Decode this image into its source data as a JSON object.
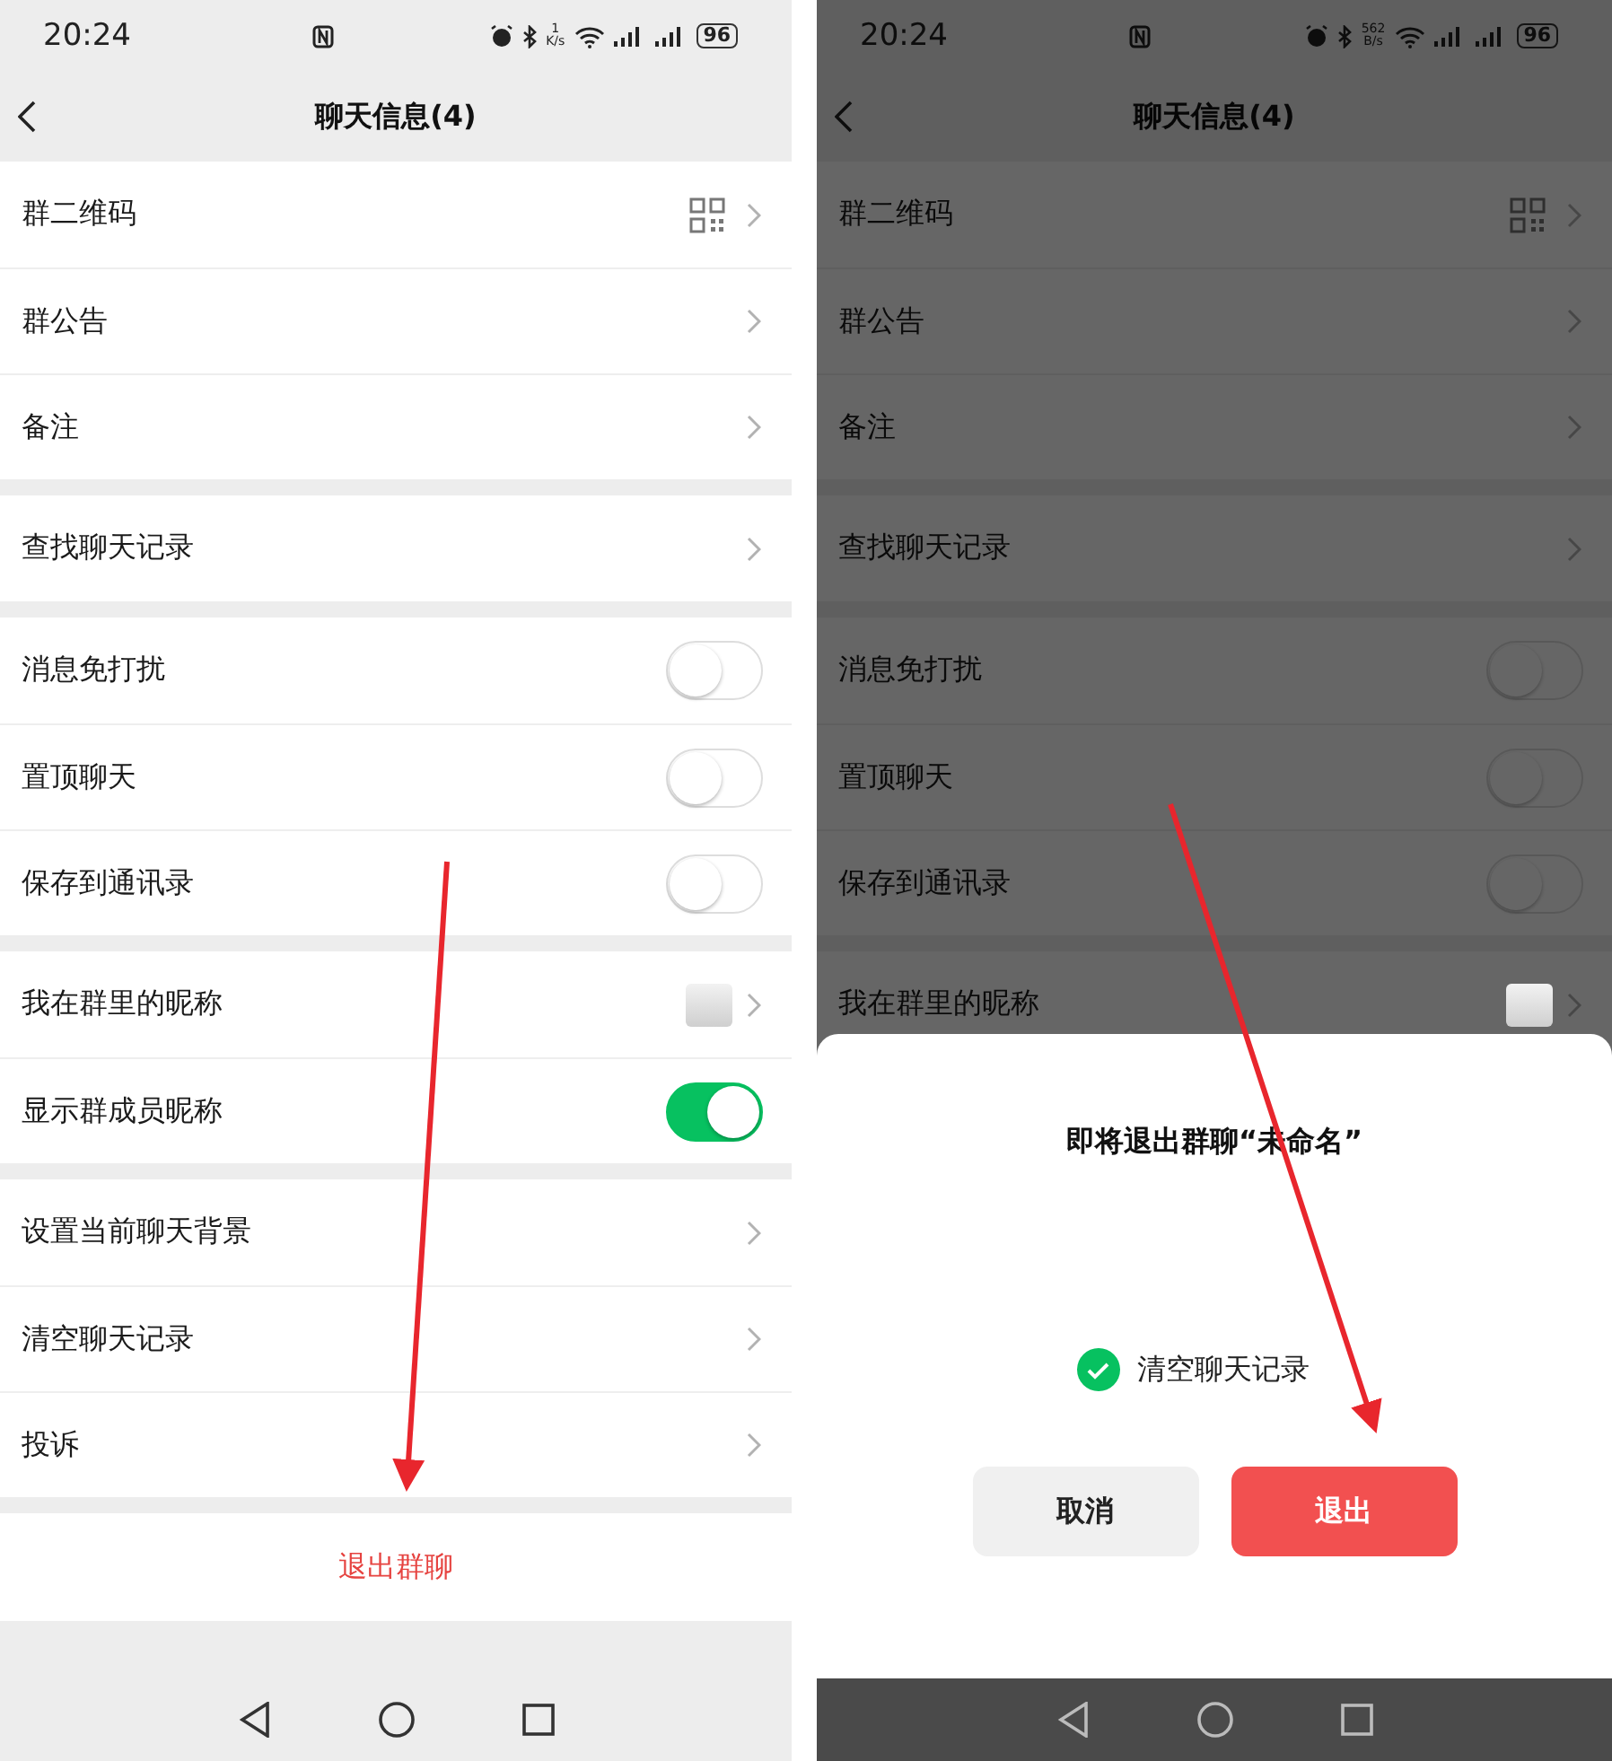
{
  "screens": [
    {
      "dimmed": false,
      "status_bar": {
        "time": "20:24",
        "speed_value": "1",
        "speed_unit": "K/s",
        "battery": "96"
      },
      "title": "聊天信息(4)",
      "groups": [
        [
          {
            "kind": "qr",
            "label": "群二维码"
          },
          {
            "kind": "link",
            "label": "群公告"
          },
          {
            "kind": "link",
            "label": "备注"
          }
        ],
        [
          {
            "kind": "link",
            "label": "查找聊天记录"
          }
        ],
        [
          {
            "kind": "toggle",
            "label": "消息免打扰",
            "on": false
          },
          {
            "kind": "toggle",
            "label": "置顶聊天",
            "on": false
          },
          {
            "kind": "toggle",
            "label": "保存到通讯录",
            "on": false
          }
        ],
        [
          {
            "kind": "nickname",
            "label": "我在群里的昵称"
          },
          {
            "kind": "toggle",
            "label": "显示群成员昵称",
            "on": true
          }
        ],
        [
          {
            "kind": "link",
            "label": "设置当前聊天背景"
          },
          {
            "kind": "link",
            "label": "清空聊天记录"
          },
          {
            "kind": "link",
            "label": "投诉"
          }
        ]
      ],
      "exit_button": "退出群聊"
    },
    {
      "dimmed": true,
      "status_bar": {
        "time": "20:24",
        "speed_value": "562",
        "speed_unit": "B/s",
        "battery": "96"
      },
      "title": "聊天信息(4)",
      "groups": [
        [
          {
            "kind": "qr",
            "label": "群二维码"
          },
          {
            "kind": "link",
            "label": "群公告"
          },
          {
            "kind": "link",
            "label": "备注"
          }
        ],
        [
          {
            "kind": "link",
            "label": "查找聊天记录"
          }
        ],
        [
          {
            "kind": "toggle",
            "label": "消息免打扰",
            "on": false
          },
          {
            "kind": "toggle",
            "label": "置顶聊天",
            "on": false
          },
          {
            "kind": "toggle",
            "label": "保存到通讯录",
            "on": false
          }
        ],
        [
          {
            "kind": "nickname",
            "label": "我在群里的昵称"
          }
        ]
      ],
      "dialog": {
        "title": "即将退出群聊“未命名”",
        "checkbox": {
          "label": "清空聊天记录",
          "checked": true
        },
        "cancel": "取消",
        "confirm": "退出"
      }
    }
  ]
}
